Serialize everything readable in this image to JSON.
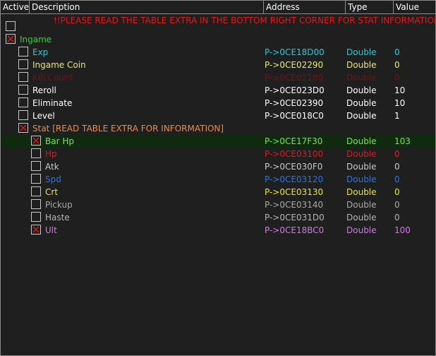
{
  "columns": {
    "active": "Active",
    "description": "Description",
    "address": "Address",
    "type": "Type",
    "value": "Value"
  },
  "banner": "!!PLEASE READ THE TABLE EXTRA IN THE BOTTOM RIGHT CORNER FOR STAT INFORMATION!!",
  "rows": [
    {
      "checked": false,
      "indent": 0,
      "description": "",
      "address": "",
      "type": "",
      "value": "",
      "color": "#ffffff"
    },
    {
      "checked": true,
      "indent": 0,
      "description": "Ingame",
      "address": "",
      "type": "",
      "value": "",
      "color": "#19e019"
    },
    {
      "checked": false,
      "indent": 1,
      "description": "Exp",
      "address": "P->0CE18D00",
      "type": "Double",
      "value": "0",
      "color": "#19d0e0"
    },
    {
      "checked": false,
      "indent": 1,
      "description": "Ingame Coin",
      "address": "P->0CE02290",
      "type": "Double",
      "value": "0",
      "color": "#e8e870"
    },
    {
      "checked": false,
      "indent": 1,
      "description": "Kill Count",
      "address": "P->0CE02180",
      "type": "Double",
      "value": "0",
      "color": "#6e1414"
    },
    {
      "checked": false,
      "indent": 1,
      "description": "Reroll",
      "address": "P->0CE023D0",
      "type": "Double",
      "value": "10",
      "color": "#ffffff"
    },
    {
      "checked": false,
      "indent": 1,
      "description": "Eliminate",
      "address": "P->0CE02390",
      "type": "Double",
      "value": "10",
      "color": "#ffffff"
    },
    {
      "checked": false,
      "indent": 1,
      "description": "Level",
      "address": "P->0CE018C0",
      "type": "Double",
      "value": "1",
      "color": "#ffffff"
    },
    {
      "checked": true,
      "indent": 1,
      "description": "Stat [READ TABLE EXTRA FOR INFORMATION]",
      "address": "",
      "type": "",
      "value": "",
      "color": "#f08a3c"
    },
    {
      "checked": true,
      "indent": 2,
      "description": "Bar Hp",
      "address": "P->0CE17F30",
      "type": "Double",
      "value": "103",
      "color": "#78e83c",
      "selected": true
    },
    {
      "checked": false,
      "indent": 2,
      "description": "Hp",
      "address": "P->0CE03100",
      "type": "Double",
      "value": "0",
      "color": "#e01919"
    },
    {
      "checked": false,
      "indent": 2,
      "description": "Atk",
      "address": "P->0CE030F0",
      "type": "Double",
      "value": "0",
      "color": "#c8c8c8"
    },
    {
      "checked": false,
      "indent": 2,
      "description": "Spd",
      "address": "P->0CE03120",
      "type": "Double",
      "value": "0",
      "color": "#1e78e8"
    },
    {
      "checked": false,
      "indent": 2,
      "description": "Crt",
      "address": "P->0CE03130",
      "type": "Double",
      "value": "0",
      "color": "#e8e81e"
    },
    {
      "checked": false,
      "indent": 2,
      "description": "Pickup",
      "address": "P->0CE03140",
      "type": "Double",
      "value": "0",
      "color": "#a8a8a8"
    },
    {
      "checked": false,
      "indent": 2,
      "description": "Haste",
      "address": "P->0CE031D0",
      "type": "Double",
      "value": "0",
      "color": "#b4b4b4"
    },
    {
      "checked": true,
      "indent": 2,
      "description": "Ult",
      "address": "P->0CE18BC0",
      "type": "Double",
      "value": "100",
      "color": "#d278e8"
    }
  ]
}
